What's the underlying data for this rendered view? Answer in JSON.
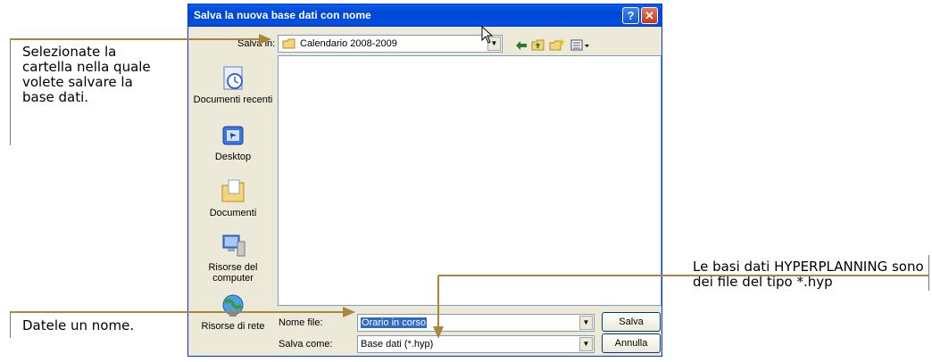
{
  "dialog": {
    "title": "Salva la nuova base dati con nome",
    "help_glyph": "?",
    "close_glyph": "✕",
    "save_in_label": "Salva in:",
    "save_in_value": "Calendario 2008-2009",
    "places": [
      {
        "label": "Documenti recenti",
        "icon": "recent-documents-icon"
      },
      {
        "label": "Desktop",
        "icon": "desktop-icon"
      },
      {
        "label": "Documenti",
        "icon": "documents-folder-icon"
      },
      {
        "label": "Risorse del computer",
        "icon": "my-computer-icon"
      },
      {
        "label": "Risorse di rete",
        "icon": "network-icon"
      }
    ],
    "filename_label": "Nome file:",
    "filename_value": "Orario in corso",
    "save_as_label": "Salva come:",
    "save_as_value": "Base dati (*.hyp)",
    "save_button": "Salva",
    "cancel_button": "Annulla"
  },
  "annotations": {
    "folder_note": "Selezionate la cartella nella quale volete salvare la base dati.",
    "name_note": "Datele un nome.",
    "type_note": "Le basi dati HYPERPLANNING sono dei file del tipo *.hyp"
  },
  "colors": {
    "arrow": "#a8863a",
    "titlebar": "#0050e0",
    "dialog_bg": "#ece9d8"
  }
}
